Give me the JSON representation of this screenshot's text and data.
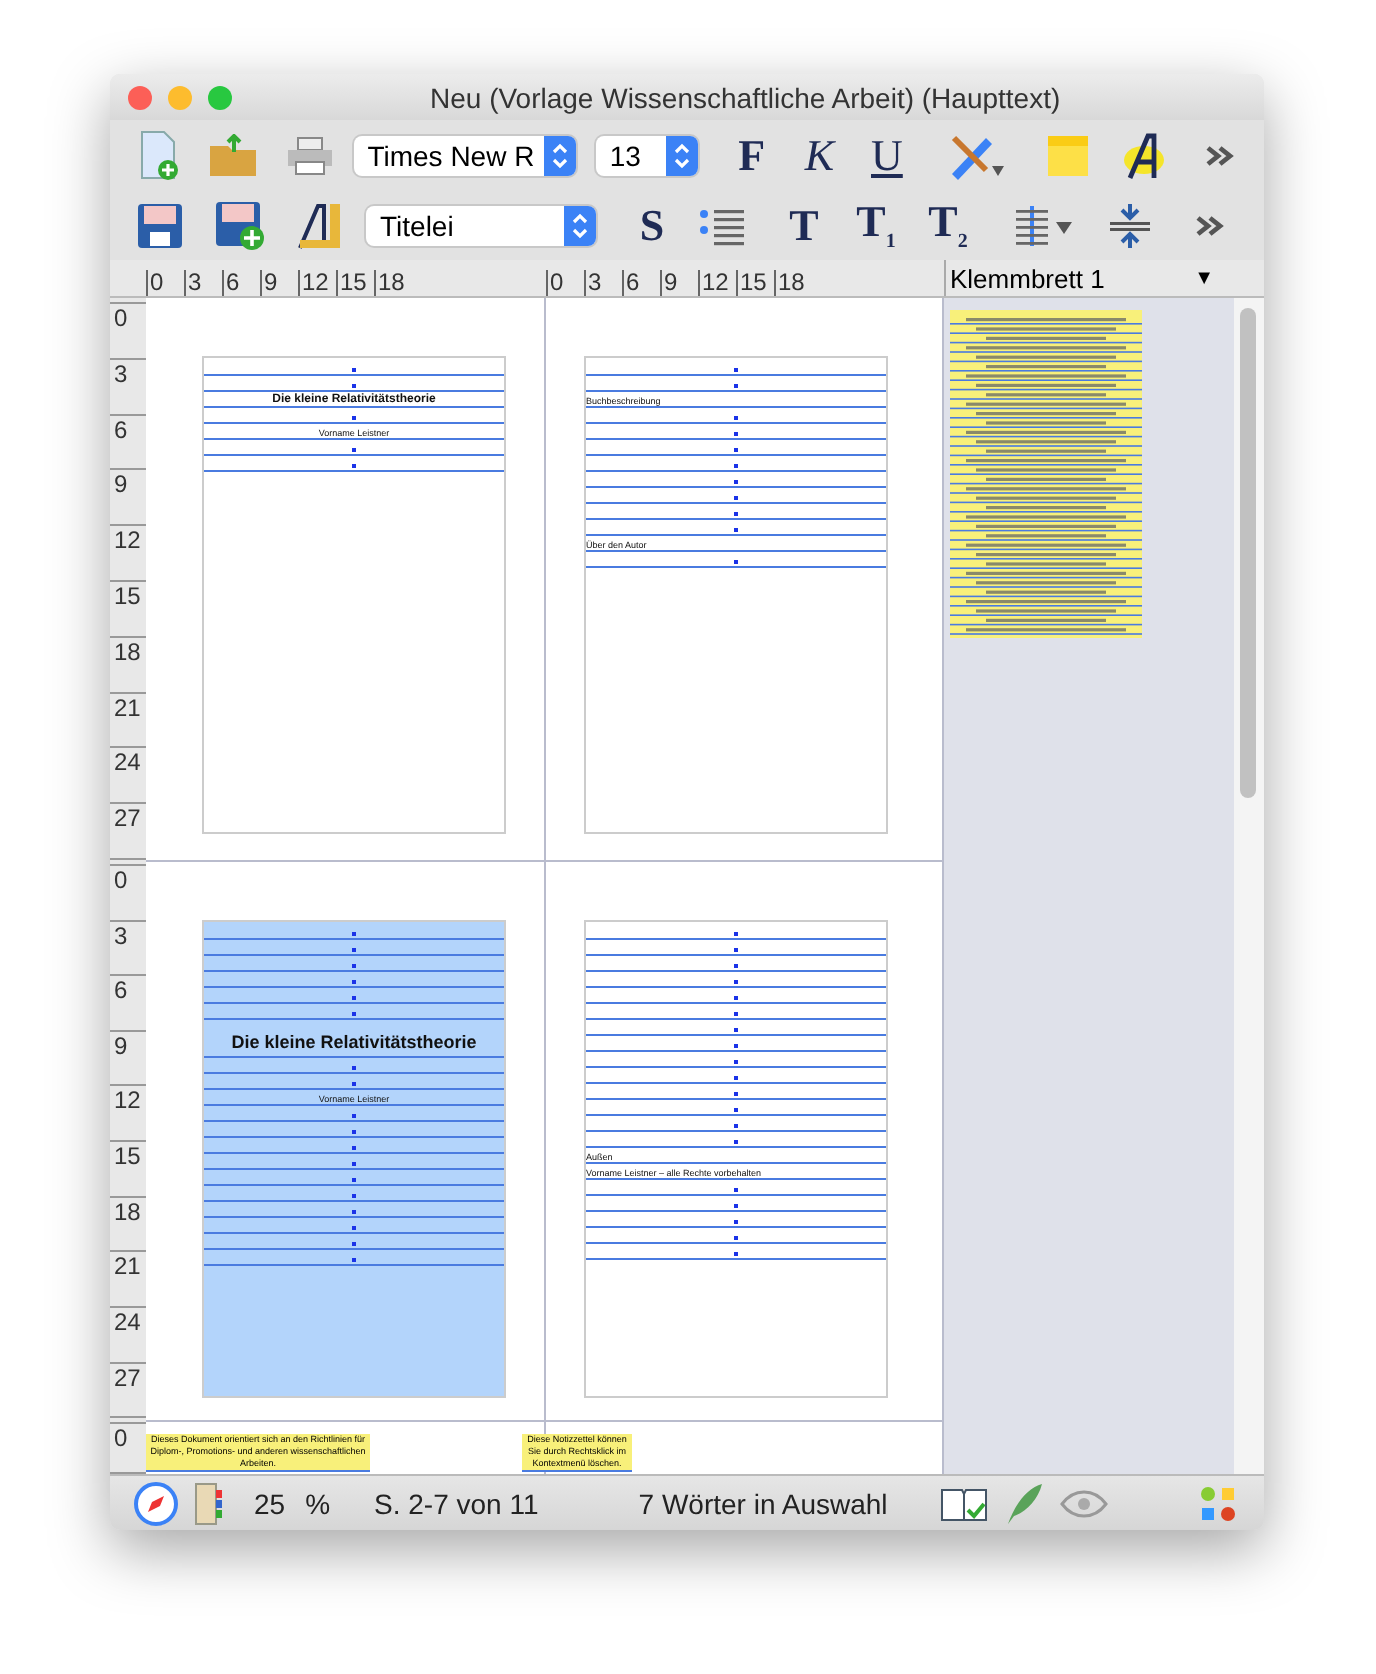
{
  "window": {
    "title": "Neu (Vorlage Wissenschaftliche Arbeit) (Haupttext)"
  },
  "toolbar": {
    "font": "Times New R",
    "size": "13",
    "style": "Titelei",
    "bold": "F",
    "italic": "K",
    "underline": "U",
    "style_s": "S",
    "t": "T",
    "t1": "T",
    "t1_sub": "1",
    "t2": "T",
    "t2_sub": "2"
  },
  "ruler": {
    "left_ticks": [
      "0",
      "3",
      "6",
      "9",
      "12",
      "15",
      "18"
    ],
    "right_ticks": [
      "0",
      "3",
      "6",
      "9",
      "12",
      "15",
      "18"
    ]
  },
  "vertical_ruler": [
    [
      "0",
      "3",
      "6",
      "9",
      "12",
      "15",
      "18",
      "21",
      "24",
      "27"
    ],
    [
      "0",
      "3",
      "6",
      "9",
      "12",
      "15",
      "18",
      "21",
      "24",
      "27"
    ],
    [
      "0"
    ]
  ],
  "pages": [
    {
      "selected": false,
      "lines": [
        {
          "kind": "blank"
        },
        {
          "kind": "blank"
        },
        {
          "kind": "title",
          "text": "Die kleine Relativitätstheorie"
        },
        {
          "kind": "blank"
        },
        {
          "kind": "center",
          "text": "Vorname Leistner"
        },
        {
          "kind": "blank"
        },
        {
          "kind": "blank"
        }
      ]
    },
    {
      "selected": false,
      "lines": [
        {
          "kind": "blank"
        },
        {
          "kind": "blank"
        },
        {
          "kind": "left",
          "text": "Buchbeschreibung"
        },
        {
          "kind": "blank"
        },
        {
          "kind": "blank"
        },
        {
          "kind": "blank"
        },
        {
          "kind": "blank"
        },
        {
          "kind": "blank"
        },
        {
          "kind": "blank"
        },
        {
          "kind": "blank"
        },
        {
          "kind": "blank"
        },
        {
          "kind": "left",
          "text": "Über den Autor"
        },
        {
          "kind": "blank"
        }
      ]
    },
    {
      "selected": true,
      "lines": [
        {
          "kind": "blank"
        },
        {
          "kind": "blank"
        },
        {
          "kind": "blank"
        },
        {
          "kind": "blank"
        },
        {
          "kind": "blank"
        },
        {
          "kind": "blank"
        },
        {
          "kind": "heading",
          "text": "Die kleine Relativitätstheorie"
        },
        {
          "kind": "blank"
        },
        {
          "kind": "blank"
        },
        {
          "kind": "center",
          "text": "Vorname Leistner"
        },
        {
          "kind": "blank"
        },
        {
          "kind": "blank"
        },
        {
          "kind": "blank"
        },
        {
          "kind": "blank"
        },
        {
          "kind": "blank"
        },
        {
          "kind": "blank"
        },
        {
          "kind": "blank"
        },
        {
          "kind": "blank"
        },
        {
          "kind": "blank"
        },
        {
          "kind": "blank"
        }
      ]
    },
    {
      "selected": false,
      "lines": [
        {
          "kind": "blank"
        },
        {
          "kind": "blank"
        },
        {
          "kind": "blank"
        },
        {
          "kind": "blank"
        },
        {
          "kind": "blank"
        },
        {
          "kind": "blank"
        },
        {
          "kind": "blank"
        },
        {
          "kind": "blank"
        },
        {
          "kind": "blank"
        },
        {
          "kind": "blank"
        },
        {
          "kind": "blank"
        },
        {
          "kind": "blank"
        },
        {
          "kind": "blank"
        },
        {
          "kind": "blank"
        },
        {
          "kind": "left",
          "text": "Außen"
        },
        {
          "kind": "left",
          "text": "Vorname Leistner – alle Rechte vorbehalten"
        },
        {
          "kind": "blank"
        },
        {
          "kind": "blank"
        },
        {
          "kind": "blank"
        },
        {
          "kind": "blank"
        },
        {
          "kind": "blank"
        }
      ]
    }
  ],
  "notes": [
    "Dieses Dokument orientiert sich an den Richtlinien für Diplom-, Promotions- und anderen wissenschaftlichen Arbeiten.",
    "Diese Notizzettel können Sie durch Rechtsklick im Kontextmenü löschen."
  ],
  "clipboard": {
    "title": "Klemmbrett 1",
    "menu_arrow": "▼"
  },
  "status_bar": {
    "zoom": "25",
    "percent": "%",
    "pages": "S. 2-7 von 11",
    "selection": "7 Wörter in Auswahl"
  }
}
